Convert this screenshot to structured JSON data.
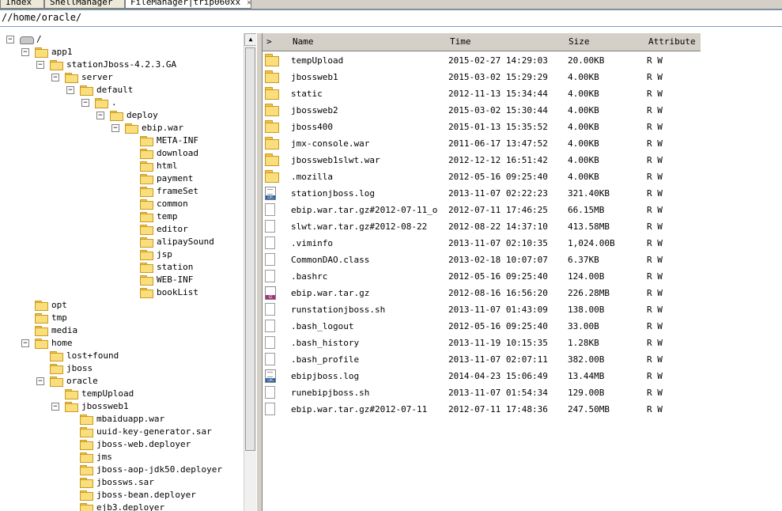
{
  "tabs": [
    {
      "label": "Index"
    },
    {
      "label": "ShellManager"
    },
    {
      "label": "FileManager|trip060xx"
    }
  ],
  "path": {
    "value": "//home/oracle/"
  },
  "tree": [
    {
      "label": "/",
      "expanded": true
    },
    {
      "label": "app1",
      "expanded": true
    },
    {
      "label": "stationJboss-4.2.3.GA",
      "expanded": true
    },
    {
      "label": "server",
      "expanded": true
    },
    {
      "label": "default",
      "expanded": true
    },
    {
      "label": ".",
      "expanded": true
    },
    {
      "label": "deploy",
      "expanded": true
    },
    {
      "label": "ebip.war",
      "expanded": true
    },
    {
      "label": "META-INF"
    },
    {
      "label": "download"
    },
    {
      "label": "html"
    },
    {
      "label": "payment"
    },
    {
      "label": "frameSet"
    },
    {
      "label": "common"
    },
    {
      "label": "temp"
    },
    {
      "label": "editor"
    },
    {
      "label": "alipaySound"
    },
    {
      "label": "jsp"
    },
    {
      "label": "station"
    },
    {
      "label": "WEB-INF"
    },
    {
      "label": "bookList"
    },
    {
      "label": "opt"
    },
    {
      "label": "tmp"
    },
    {
      "label": "media"
    },
    {
      "label": "home",
      "expanded": true
    },
    {
      "label": "lost+found"
    },
    {
      "label": "jboss"
    },
    {
      "label": "oracle",
      "expanded": true
    },
    {
      "label": "tempUpload"
    },
    {
      "label": "jbossweb1",
      "expanded": true
    },
    {
      "label": "mbaiduapp.war"
    },
    {
      "label": "uuid-key-generator.sar"
    },
    {
      "label": "jboss-web.deployer"
    },
    {
      "label": "jms"
    },
    {
      "label": "jboss-aop-jdk50.deployer"
    },
    {
      "label": "jbossws.sar"
    },
    {
      "label": "jboss-bean.deployer"
    },
    {
      "label": "ejb3.deployer"
    }
  ],
  "list": {
    "headers": {
      "toggle": ">",
      "name": "Name",
      "time": "Time",
      "size": "Size",
      "attr": "Attribute"
    },
    "rows": [
      {
        "icon": "folder-icon",
        "name": "tempUpload",
        "time": "2015-02-27 14:29:03",
        "size": "20.00KB",
        "attr": "R W"
      },
      {
        "icon": "folder-icon",
        "name": "jbossweb1",
        "time": "2015-03-02 15:29:29",
        "size": "4.00KB",
        "attr": "R W"
      },
      {
        "icon": "folder-icon",
        "name": "static",
        "time": "2012-11-13 15:34:44",
        "size": "4.00KB",
        "attr": "R W"
      },
      {
        "icon": "folder-icon",
        "name": "jbossweb2",
        "time": "2015-03-02 15:30:44",
        "size": "4.00KB",
        "attr": "R W"
      },
      {
        "icon": "folder-icon",
        "name": "jboss400",
        "time": "2015-01-13 15:35:52",
        "size": "4.00KB",
        "attr": "R W"
      },
      {
        "icon": "folder-icon",
        "name": "jmx-console.war",
        "time": "2011-06-17 13:47:52",
        "size": "4.00KB",
        "attr": "R W"
      },
      {
        "icon": "folder-icon",
        "name": "jbossweb1slwt.war",
        "time": "2012-12-12 16:51:42",
        "size": "4.00KB",
        "attr": "R W"
      },
      {
        "icon": "folder-icon",
        "name": ".mozilla",
        "time": "2012-05-16 09:25:40",
        "size": "4.00KB",
        "attr": "R W"
      },
      {
        "icon": "log-file-icon",
        "name": "stationjboss.log",
        "time": "2013-11-07 02:22:23",
        "size": "321.40KB",
        "attr": "R W"
      },
      {
        "icon": "file-icon",
        "name": "ebip.war.tar.gz#2012-07-11_o",
        "time": "2012-07-11 17:46:25",
        "size": "66.15MB",
        "attr": "R W"
      },
      {
        "icon": "file-icon",
        "name": "slwt.war.tar.gz#2012-08-22",
        "time": "2012-08-22 14:37:10",
        "size": "413.58MB",
        "attr": "R W"
      },
      {
        "icon": "file-icon",
        "name": ".viminfo",
        "time": "2013-11-07 02:10:35",
        "size": "1,024.00B",
        "attr": "R W"
      },
      {
        "icon": "file-icon",
        "name": "CommonDAO.class",
        "time": "2013-02-18 10:07:07",
        "size": "6.37KB",
        "attr": "R W"
      },
      {
        "icon": "file-icon",
        "name": ".bashrc",
        "time": "2012-05-16 09:25:40",
        "size": "124.00B",
        "attr": "R W"
      },
      {
        "icon": "gz-file-icon",
        "name": "ebip.war.tar.gz",
        "time": "2012-08-16 16:56:20",
        "size": "226.28MB",
        "attr": "R W"
      },
      {
        "icon": "file-icon",
        "name": "runstationjboss.sh",
        "time": "2013-11-07 01:43:09",
        "size": "138.00B",
        "attr": "R W"
      },
      {
        "icon": "file-icon",
        "name": ".bash_logout",
        "time": "2012-05-16 09:25:40",
        "size": "33.00B",
        "attr": "R W"
      },
      {
        "icon": "file-icon",
        "name": ".bash_history",
        "time": "2013-11-19 10:15:35",
        "size": "1.28KB",
        "attr": "R W"
      },
      {
        "icon": "file-icon",
        "name": ".bash_profile",
        "time": "2013-11-07 02:07:11",
        "size": "382.00B",
        "attr": "R W"
      },
      {
        "icon": "log-file-icon",
        "name": "ebipjboss.log",
        "time": "2014-04-23 15:06:49",
        "size": "13.44MB",
        "attr": "R W"
      },
      {
        "icon": "file-icon",
        "name": "runebipjboss.sh",
        "time": "2013-11-07 01:54:34",
        "size": "129.00B",
        "attr": "R W"
      },
      {
        "icon": "file-icon",
        "name": "ebip.war.tar.gz#2012-07-11",
        "time": "2012-07-11 17:48:36",
        "size": "247.50MB",
        "attr": "R W"
      }
    ]
  }
}
